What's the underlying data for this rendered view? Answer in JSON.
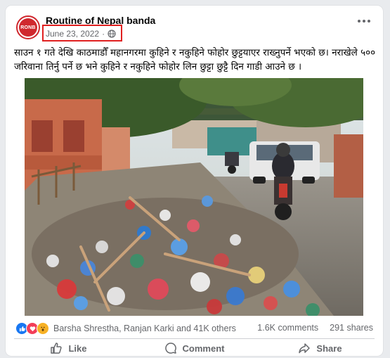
{
  "page": {
    "name": "Routine of Nepal banda",
    "avatar_text": "RONB",
    "date": "June 23, 2022",
    "separator": "·",
    "privacy_icon": "globe-icon",
    "more_icon": "more-dots-icon"
  },
  "post": {
    "text": "साउन १ गते देखि काठमाडौँ महानगरमा कुहिने र नकुहिने फोहोर छुट्टयाएर राख्नुपर्ने भएको छ। नराखेले ५०० जरिवाना तिर्नु पर्ने छ भने कुहिने र नकुहिने फोहोर लिन छुट्टा छुट्टै दिन गाडी आउने छ ।"
  },
  "engagement": {
    "reaction_icons": [
      "like-reaction-icon",
      "love-reaction-icon",
      "wow-reaction-icon"
    ],
    "reaction_names": "Barsha Shrestha, Ranjan Karki and 41K others",
    "comments": "1.6K comments",
    "shares": "291 shares"
  },
  "actions": {
    "like": "Like",
    "comment": "Comment",
    "share": "Share"
  },
  "colors": {
    "accent": "#1877f2",
    "highlight_box": "#e02020",
    "brand": "#d0282e"
  }
}
